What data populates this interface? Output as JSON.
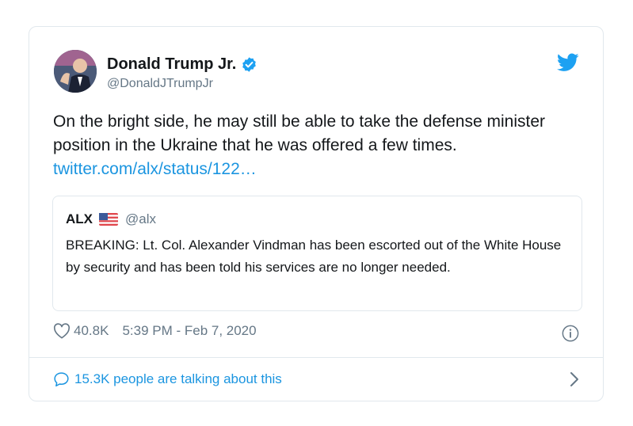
{
  "tweet": {
    "author": {
      "name": "Donald Trump Jr.",
      "handle": "@DonaldJTrumpJr",
      "avatar_icon": "profile-photo",
      "verified_icon": "verified-badge-icon"
    },
    "brand_icon": "twitter-bird-icon",
    "text": "On the bright side, he may still be able to take the defense minister position in the Ukraine that he was offered a few times.",
    "link": "twitter.com/alx/status/122…",
    "quote": {
      "name": "ALX",
      "flag_icon": "us-flag-icon",
      "handle": "@alx",
      "text": "BREAKING: Lt. Col. Alexander Vindman has been escorted out of the White House by security and has been told his services are no longer needed."
    },
    "likes": "40.8K",
    "timestamp": "5:39 PM - Feb 7, 2020",
    "footer": {
      "talking": "15.3K people are talking about this"
    }
  },
  "colors": {
    "accent": "#1b95e0",
    "muted": "#657786",
    "border": "#e1e8ed",
    "text": "#14171a"
  }
}
